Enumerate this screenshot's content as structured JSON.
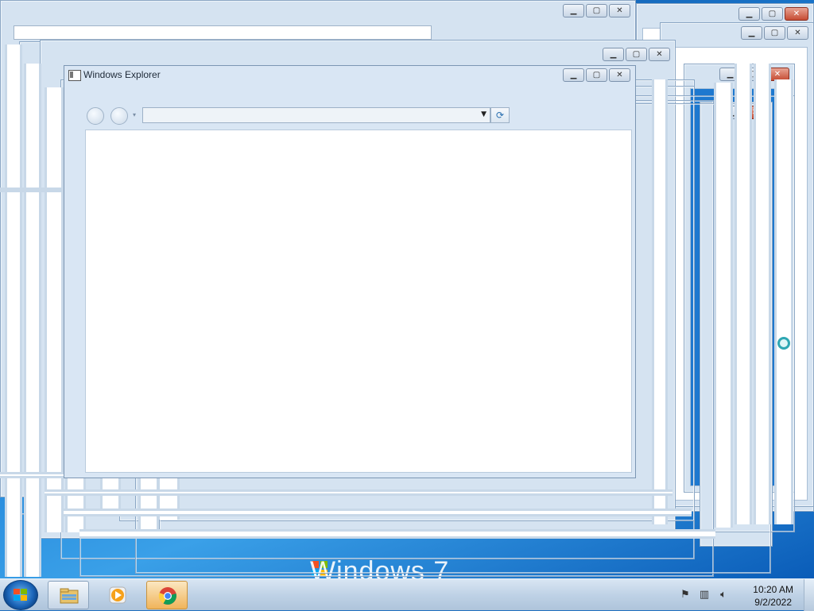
{
  "desktop": {
    "wallpaper_text": "Windows 7"
  },
  "explorer": {
    "title": "Windows Explorer",
    "address_value": "",
    "minimize_glyph": "▁",
    "maximize_glyph": "▢",
    "close_glyph": "✕",
    "refresh_glyph": "⟳",
    "dropdown_glyph": "▾"
  },
  "ghost_windows": {
    "minimize_glyph": "▁",
    "maximize_glyph": "▢",
    "close_glyph": "✕"
  },
  "taskbar": {
    "start_label": "Start",
    "pinned": [
      {
        "name": "Windows Explorer",
        "icon": "folder-icon"
      },
      {
        "name": "Windows Media Player",
        "icon": "media-player-icon"
      },
      {
        "name": "Google Chrome",
        "icon": "chrome-icon"
      }
    ],
    "clock_time": "10:20 AM",
    "clock_date": "9/2/2022"
  },
  "tray": {
    "icons": [
      "action-center-icon",
      "network-icon",
      "volume-icon"
    ]
  }
}
